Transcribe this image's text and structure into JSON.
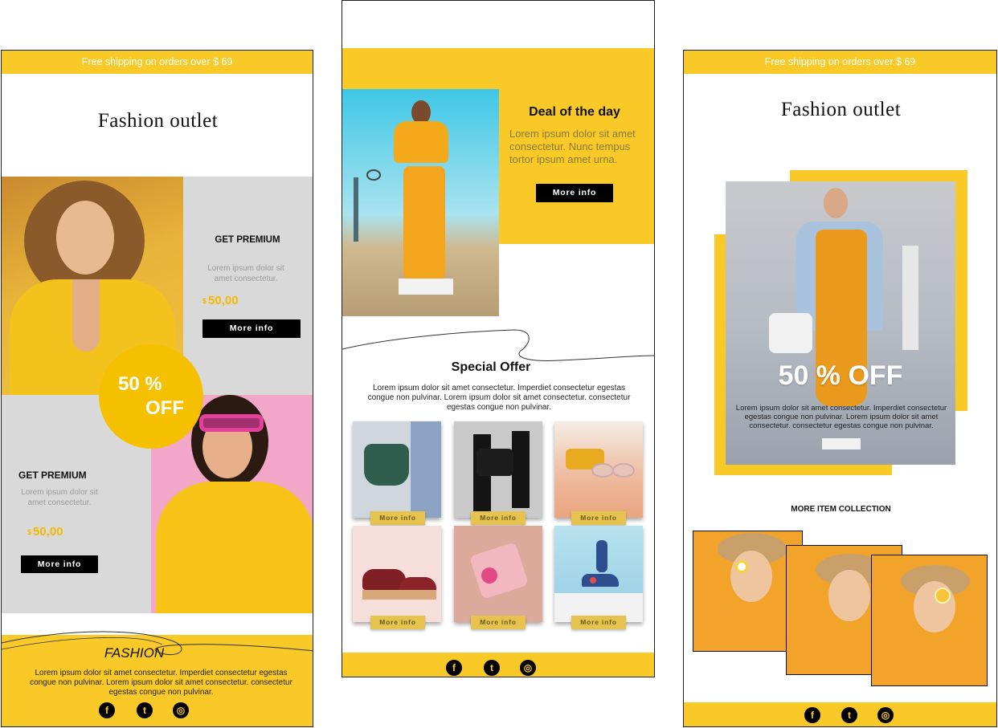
{
  "panel1": {
    "shipping": "Free shipping on orders over $ 69",
    "title": "Fashion outlet",
    "promo1": {
      "heading": "GET PREMIUM",
      "text": "Lorem ipsum dolor sit amet consectetur.",
      "currency": "$",
      "price": "50,00",
      "button": "More info"
    },
    "discount": {
      "line1": "50 %",
      "line2": "OFF"
    },
    "promo2": {
      "heading": "GET PREMIUM",
      "text": "Lorem ipsum dolor sit amet consectetur.",
      "currency": "$",
      "price": "50,00",
      "button": "More info"
    },
    "footer": {
      "heading": "FASHION",
      "text": "Lorem ipsum dolor sit amet consectetur. Imperdiet consectetur egestas congue non pulvinar. Lorem ipsum dolor sit amet consectetur. consectetur egestas congue non pulvinar."
    }
  },
  "panel2": {
    "deal": {
      "heading": "Deal of the day",
      "text": "Lorem ipsum dolor sit amet consectetur. Nunc tempus tortor ipsum amet urna.",
      "button": "More info"
    },
    "offer": {
      "heading": "Special Offer",
      "text": "Lorem ipsum dolor sit amet consectetur. Imperdiet consectetur egestas congue non pulvinar. Lorem ipsum dolor sit amet consectetur. consectetur egestas congue non pulvinar."
    },
    "products": [
      {
        "name": "green-bag",
        "button": "More info"
      },
      {
        "name": "black-boots-bag",
        "button": "More info"
      },
      {
        "name": "sunglasses",
        "button": "More info"
      },
      {
        "name": "platform-sandals",
        "button": "More info"
      },
      {
        "name": "pink-clutch",
        "button": "More info"
      },
      {
        "name": "floral-heels",
        "button": "More info"
      }
    ]
  },
  "panel3": {
    "shipping": "Free shipping on orders over $ 69",
    "title": "Fashion outlet",
    "hero": {
      "discount": "50 % OFF",
      "text": "Lorem ipsum dolor sit amet consectetur. Imperdiet consectetur egestas congue non pulvinar. Lorem ipsum dolor sit amet consectetur. consectetur egestas congue non pulvinar."
    },
    "collection": {
      "heading": "MORE ITEM COLLECTION"
    }
  },
  "social": {
    "facebook": "f",
    "twitter": "t",
    "instagram": "◎"
  },
  "colors": {
    "accent": "#f9c928",
    "black": "#000000",
    "panel_gray": "#d9d9d9",
    "pink": "#f2a6c8",
    "orange_photo": "#f2a42a"
  }
}
